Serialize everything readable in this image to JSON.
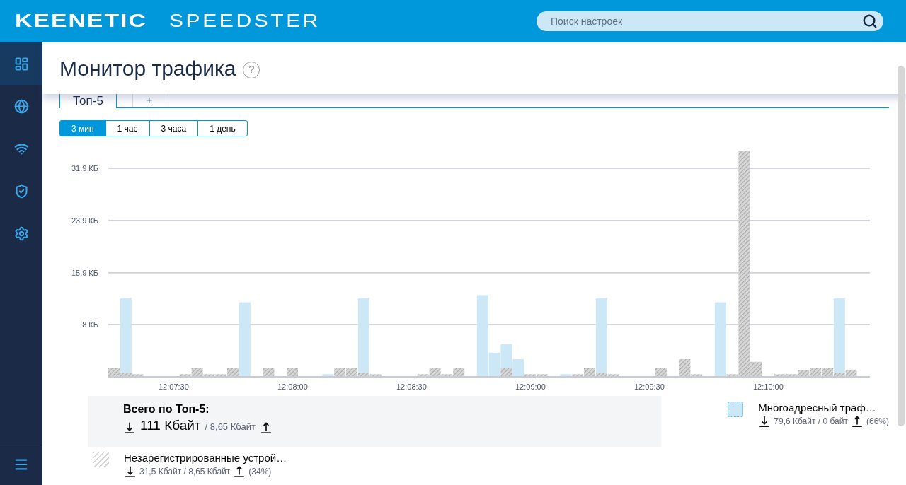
{
  "header": {
    "logo_brand": "KEENETIC",
    "logo_model": "SPEEDSTER",
    "search": {
      "placeholder": "Поиск настроек"
    }
  },
  "sidebar": {
    "items": [
      {
        "kind": "dashboard",
        "selected": true
      },
      {
        "kind": "internet",
        "selected": false
      },
      {
        "kind": "wifi",
        "selected": false
      },
      {
        "kind": "security",
        "selected": false
      },
      {
        "kind": "settings",
        "selected": false
      }
    ]
  },
  "page_title": "Монитор трафика",
  "help": "?",
  "tabs": [
    {
      "kind": "text",
      "label": "Топ-5",
      "selected": true
    },
    {
      "kind": "blank",
      "selected": false
    },
    {
      "kind": "text",
      "label": "+",
      "selected": false
    }
  ],
  "ranges": [
    {
      "label": "3 мин",
      "selected": true
    },
    {
      "label": "1 час",
      "selected": false
    },
    {
      "label": "3 часа",
      "selected": false
    },
    {
      "label": "1 день",
      "selected": false
    }
  ],
  "chart_data": {
    "type": "bar",
    "stacked": true,
    "categories": [
      null,
      null,
      null,
      null,
      null,
      "12:07:30",
      null,
      null,
      null,
      null,
      null,
      null,
      null,
      null,
      null,
      "12:08:00",
      null,
      null,
      null,
      null,
      null,
      null,
      null,
      null,
      null,
      "12:08:30",
      null,
      null,
      null,
      null,
      null,
      null,
      null,
      null,
      null,
      "12:09:00",
      null,
      null,
      null,
      null,
      null,
      null,
      null,
      null,
      null,
      "12:09:30",
      null,
      null,
      null,
      null,
      null,
      null,
      null,
      null,
      null,
      "12:10:00",
      null,
      null,
      null,
      null,
      null,
      null,
      null,
      null
    ],
    "grid": true,
    "ylim": [
      0,
      34.6
    ],
    "yticks": [
      {
        "value": 8,
        "label": "8 КБ"
      },
      {
        "value": 15.9,
        "label": "15.9 КБ"
      },
      {
        "value": 23.9,
        "label": "23.9 КБ"
      },
      {
        "value": 31.9,
        "label": "31.9 КБ"
      }
    ],
    "series": [
      {
        "name": "Незарегистрированные устрой…",
        "color": "#d6d6d6",
        "values": [
          1.3,
          0.6,
          0.4,
          0,
          0,
          0,
          0.4,
          1.3,
          0.4,
          0.4,
          1.3,
          0,
          0,
          1.3,
          0,
          1.3,
          0,
          0,
          0,
          1.3,
          1.3,
          0.6,
          0.4,
          0,
          0,
          0,
          0.4,
          1.3,
          0.4,
          1.3,
          0,
          0,
          0,
          1.3,
          0,
          0.4,
          0.4,
          0,
          0,
          0.4,
          1.3,
          0.6,
          0.4,
          0,
          0,
          0,
          1.3,
          0,
          2.7,
          0.4,
          0,
          0,
          0.4,
          34.6,
          2.3,
          0,
          0.4,
          0.4,
          1.0,
          1.3,
          1.3,
          0.6,
          1.1,
          0
        ]
      },
      {
        "name": "Многоадресный траф…",
        "color": "#cce8f6",
        "values": [
          0,
          11.5,
          0,
          0,
          0,
          0,
          0,
          0,
          0,
          0,
          0,
          11.4,
          0,
          0,
          0,
          0,
          0,
          0,
          0.4,
          0,
          0,
          11.5,
          0,
          0,
          0,
          0,
          0,
          0,
          0,
          0,
          0,
          12.5,
          3.7,
          3.7,
          2.7,
          0,
          0,
          0,
          0.4,
          0,
          0,
          11.5,
          0,
          0,
          0,
          0,
          0,
          0,
          0,
          0,
          0,
          11.4,
          0,
          0,
          0,
          0,
          0,
          0,
          0,
          0,
          0,
          11.5,
          0,
          0
        ]
      }
    ]
  },
  "summary": {
    "title": "Всего по Топ-5:",
    "download": "111 Кбайт",
    "upload": "/ 8,65 Кбайт"
  },
  "legend": [
    {
      "kind": "solid",
      "stats": "79,6 Кбайт / 0 байт",
      "share": "(66%)"
    },
    {
      "kind": "hatched",
      "stats": "31,5 Кбайт / 8,65 Кбайт",
      "share": "(34%)"
    }
  ]
}
